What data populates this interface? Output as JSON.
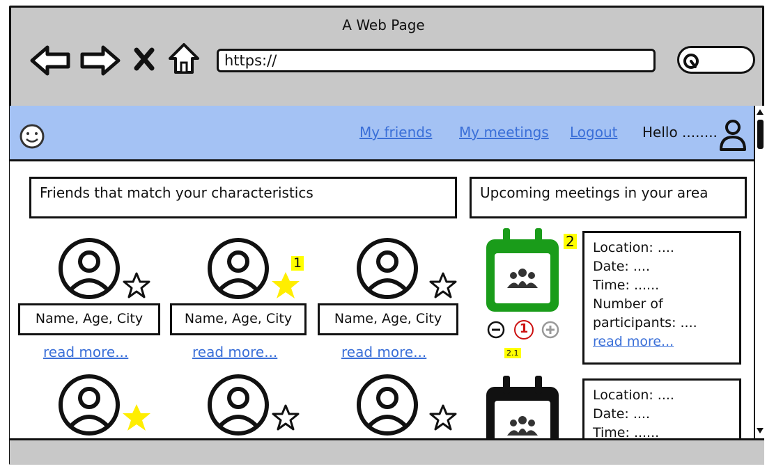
{
  "window": {
    "title": "A Web Page"
  },
  "address_bar": {
    "value": "https://"
  },
  "nav": {
    "links": [
      "My friends",
      "My meetings",
      "Logout"
    ],
    "greeting": "Hello ........"
  },
  "friends_section": {
    "header": "Friends that match your characteristics",
    "cards": [
      {
        "name": "Name, Age, City",
        "read_more": "read more...",
        "favorite": false
      },
      {
        "name": "Name, Age, City",
        "read_more": "read more...",
        "favorite": true,
        "badge": "1"
      },
      {
        "name": "Name, Age, City",
        "read_more": "read more...",
        "favorite": false
      },
      {
        "favorite": true
      },
      {
        "favorite": false
      },
      {
        "favorite": false
      }
    ]
  },
  "meetings_section": {
    "header": "Upcoming meetings in your area",
    "meetings": [
      {
        "badge": "2",
        "calendar_color": "#1a9c1a",
        "count": "1",
        "count_badge": "2.1",
        "details": [
          "Location: ....",
          "Date: ....",
          "Time: ......",
          "Number of participants: ...."
        ],
        "read_more": "read more..."
      },
      {
        "calendar_color": "#111111",
        "details": [
          "Location: ....",
          "Date: ....",
          "Time: ......"
        ]
      }
    ]
  },
  "colors": {
    "navbar": "#a4c2f4",
    "link": "#3a6fd8",
    "star_filled": "#ffee00",
    "highlight": "#ffff00",
    "count": "#cc1111"
  }
}
